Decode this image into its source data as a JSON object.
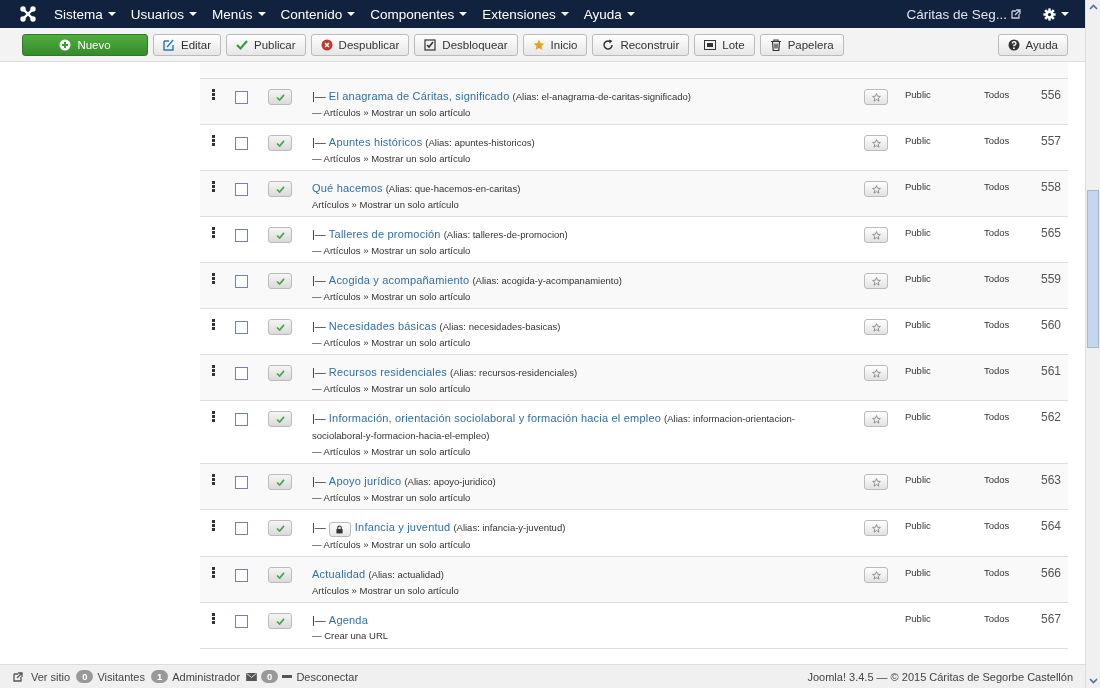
{
  "navbar": {
    "menus": [
      "Sistema",
      "Usuarios",
      "Menús",
      "Contenido",
      "Componentes",
      "Extensiones",
      "Ayuda"
    ],
    "site_link": "Cáritas de Seg..."
  },
  "toolbar": {
    "buttons": [
      {
        "label": "Nuevo",
        "kind": "new"
      },
      {
        "label": "Editar",
        "kind": "edit"
      },
      {
        "label": "Publicar",
        "kind": "publish"
      },
      {
        "label": "Despublicar",
        "kind": "unpublish"
      },
      {
        "label": "Desbloquear",
        "kind": "checkin"
      },
      {
        "label": "Inicio",
        "kind": "home"
      },
      {
        "label": "Reconstruir",
        "kind": "rebuild"
      },
      {
        "label": "Lote",
        "kind": "batch"
      },
      {
        "label": "Papelera",
        "kind": "trash"
      }
    ],
    "help": "Ayuda"
  },
  "items": [
    {
      "prefix": "|—",
      "title": "El anagrama de Cáritas, significado",
      "alias": "(Alias: el-anagrama-de-caritas-significado)",
      "type": "— Artículos » Mostrar un solo artículo",
      "checked": false,
      "published": true,
      "locked": false,
      "default_toggle": true,
      "access": "Public",
      "language": "Todos",
      "id": "556"
    },
    {
      "prefix": "|—",
      "title": "Apuntes históricos",
      "alias": "(Alias: apuntes-historicos)",
      "type": "— Artículos » Mostrar un solo artículo",
      "checked": false,
      "published": true,
      "locked": false,
      "default_toggle": true,
      "access": "Public",
      "language": "Todos",
      "id": "557"
    },
    {
      "title": "Qué hacemos",
      "alias": "(Alias: que-hacemos-en-caritas)",
      "type": "Artículos » Mostrar un solo artículo",
      "checked": false,
      "published": true,
      "locked": false,
      "default_toggle": true,
      "access": "Public",
      "language": "Todos",
      "id": "558"
    },
    {
      "prefix": "|—",
      "title": "Talleres de promoción",
      "alias": "(Alias: talleres-de-promocion)",
      "type": "— Artículos » Mostrar un solo artículo",
      "checked": false,
      "published": true,
      "locked": false,
      "default_toggle": true,
      "access": "Public",
      "language": "Todos",
      "id": "565"
    },
    {
      "prefix": "|—",
      "title": "Acogida y acompañamiento",
      "alias": "(Alias: acogida-y-acompanamiento)",
      "type": "— Artículos » Mostrar un solo artículo",
      "checked": false,
      "published": true,
      "locked": false,
      "default_toggle": true,
      "access": "Public",
      "language": "Todos",
      "id": "559"
    },
    {
      "prefix": "|—",
      "title": "Necesidades básicas",
      "alias": "(Alias: necesidades-basicas)",
      "type": "— Artículos » Mostrar un solo artículo",
      "checked": false,
      "published": true,
      "locked": false,
      "default_toggle": true,
      "access": "Public",
      "language": "Todos",
      "id": "560"
    },
    {
      "prefix": "|—",
      "title": "Recursos residenciales",
      "alias": "(Alias: recursos-residenciales)",
      "type": "— Artículos » Mostrar un solo artículo",
      "checked": false,
      "published": true,
      "locked": false,
      "default_toggle": true,
      "access": "Public",
      "language": "Todos",
      "id": "561"
    },
    {
      "prefix": "|—",
      "title": "Información, orientación sociolaboral y formación hacia el empleo",
      "alias": "(Alias: informacion-orientacion-sociolaboral-y-formacion-hacia-el-empleo)",
      "type": "— Artículos » Mostrar un solo artículo",
      "checked": false,
      "published": true,
      "locked": false,
      "default_toggle": true,
      "access": "Public",
      "language": "Todos",
      "id": "562"
    },
    {
      "prefix": "|—",
      "title": "Apoyo jurídico",
      "alias": "(Alias: apoyo-juridico)",
      "type": "— Artículos » Mostrar un solo artículo",
      "checked": false,
      "published": true,
      "locked": false,
      "default_toggle": true,
      "access": "Public",
      "language": "Todos",
      "id": "563"
    },
    {
      "prefix": "|—",
      "title": "Infancia y juventud",
      "alias": "(Alias: infancia-y-juventud)",
      "type": "— Artículos » Mostrar un solo artículo",
      "checked": false,
      "published": true,
      "locked": true,
      "default_toggle": true,
      "access": "Public",
      "language": "Todos",
      "id": "564"
    },
    {
      "title": "Actualidad",
      "alias": "(Alias: actualidad)",
      "type": "Artículos » Mostrar un solo artículo",
      "checked": false,
      "published": true,
      "locked": false,
      "default_toggle": true,
      "access": "Public",
      "language": "Todos",
      "id": "566"
    },
    {
      "prefix": "|—",
      "title": "Agenda",
      "type": "— Crear una URL",
      "checked": false,
      "published": true,
      "locked": false,
      "default_toggle": false,
      "access": "Public",
      "language": "Todos",
      "id": "567"
    }
  ],
  "status_bar": {
    "view_site": "Ver sitio",
    "visitors_count": "0",
    "visitors": "Visitantes",
    "admins_count": "1",
    "admins": "Administrador",
    "messages_count": "0",
    "logout": "Desconectar",
    "footer": "Joomla! 3.4.5 — © 2015 Cáritas de Segorbe Castellón"
  }
}
